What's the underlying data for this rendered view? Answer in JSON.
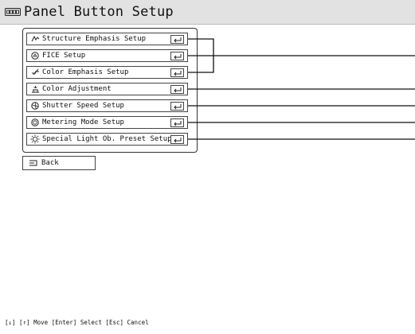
{
  "title": {
    "text": "Panel Button Setup",
    "icon": "panel-buttons-icon"
  },
  "menu": {
    "items": [
      {
        "label": "Structure Emphasis Setup",
        "icon": "structure-emphasis-icon",
        "key": "enter-key-icon"
      },
      {
        "label": "FICE Setup",
        "icon": "fice-icon",
        "key": "enter-key-icon"
      },
      {
        "label": "Color Emphasis Setup",
        "icon": "color-emphasis-icon",
        "key": "enter-key-icon"
      },
      {
        "label": "Color Adjustment",
        "icon": "color-adjustment-icon",
        "key": "enter-key-icon"
      },
      {
        "label": "Shutter Speed Setup",
        "icon": "shutter-speed-icon",
        "key": "enter-key-icon"
      },
      {
        "label": "Metering Mode Setup",
        "icon": "metering-mode-icon",
        "key": "enter-key-icon"
      },
      {
        "label": "Special Light Ob. Preset Setup",
        "icon": "special-light-icon",
        "key": "enter-key-icon"
      }
    ]
  },
  "back": {
    "label": "Back",
    "icon": "back-icon"
  },
  "status": {
    "text": "[↓] [↑] Move  [Enter] Select  [Esc] Cancel"
  }
}
